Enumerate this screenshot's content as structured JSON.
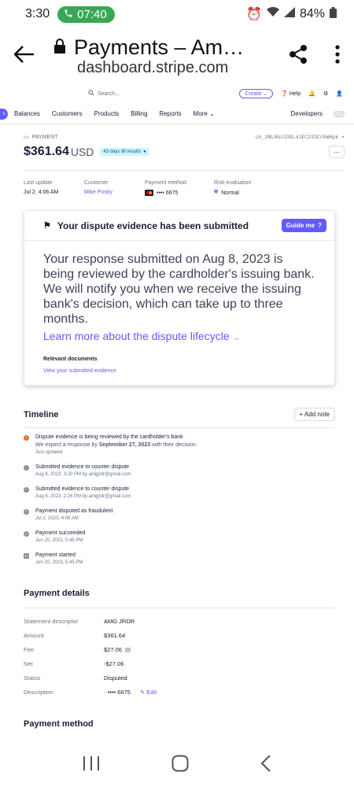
{
  "status": {
    "time": "3:30",
    "call_time": "07:40",
    "battery": "84%"
  },
  "browser": {
    "title": "Payments – Am…",
    "url": "dashboard.stripe.com"
  },
  "topbar": {
    "search_placeholder": "Search...",
    "create": "Create",
    "help": "Help"
  },
  "nav": {
    "items": [
      "Balances",
      "Customers",
      "Products",
      "Billing",
      "Reports",
      "More"
    ],
    "developers": "Developers"
  },
  "payment": {
    "label": "PAYMENT",
    "id": "ch_3NL8bzIOGL4JEC2IOCr6WHpk",
    "amount": "$361.64",
    "currency": "USD",
    "badge": "43 days till results",
    "meta": {
      "last_update_label": "Last update",
      "last_update": "Jul 2, 4:06 AM",
      "customer_label": "Customer",
      "customer": "Mike Postiy",
      "method_label": "Payment method",
      "method": "•••• 6675",
      "risk_label": "Risk evaluation",
      "risk": "Normal"
    }
  },
  "dispute": {
    "title": "Your dispute evidence has been submitted",
    "guide": "Guide me",
    "body": "Your response submitted on Aug 8, 2023 is being reviewed by the cardholder's issuing bank. We will notify you when we receive the issuing bank's decision, which can take up to three months.",
    "link": "Learn more about the dispute lifecycle",
    "docs_label": "Relevant documents",
    "docs_link": "View your submitted evidence"
  },
  "timeline": {
    "title": "Timeline",
    "add_note": "+ Add note",
    "items": [
      {
        "title": "Dispute evidence is being reviewed by the cardholder's bank",
        "sub_pre": "We expect a response by ",
        "sub_bold": "September 27, 2023",
        "sub_post": " with their decision.",
        "time": "Just updated"
      },
      {
        "title": "Submitted evidence to counter dispute",
        "time": "Aug 8, 2023, 3:20 PM by amgjrdr@gmail.com"
      },
      {
        "title": "Submitted evidence to counter dispute",
        "time": "Aug 8, 2023, 2:26 PM by amgjrdr@gmail.com"
      },
      {
        "title": "Payment disputed as fraudulent",
        "time": "Jul 2, 2023, 4:06 AM"
      },
      {
        "title": "Payment succeeded",
        "time": "Jun 20, 2023, 5:45 PM"
      },
      {
        "title": "Payment started",
        "time": "Jun 20, 2023, 5:45 PM"
      }
    ]
  },
  "details": {
    "title": "Payment details",
    "rows": [
      {
        "k": "Statement descriptor",
        "v": "AMG JRDR"
      },
      {
        "k": "Amount",
        "v": "$361.64"
      },
      {
        "k": "Fee",
        "v": "$27.06"
      },
      {
        "k": "Net",
        "v": "-$27.06"
      },
      {
        "k": "Status",
        "v": "Disputed"
      },
      {
        "k": "Description",
        "v": "· •••• 6675"
      }
    ],
    "edit": "Edit"
  },
  "method_title": "Payment method",
  "colors": {
    "accent": "#635bff",
    "call": "#3aa757",
    "warn": "#e5701f"
  }
}
